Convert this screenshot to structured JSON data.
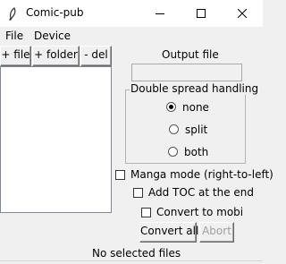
{
  "window": {
    "title": "Comic-pub"
  },
  "menu": {
    "items": [
      "File",
      "Device"
    ]
  },
  "toolbar": {
    "add_file": "+ file",
    "add_folder": "+ folder",
    "delete": "- del"
  },
  "output": {
    "label": "Output file",
    "value": ""
  },
  "spread": {
    "title": "Double spread handling",
    "options": [
      "none",
      "split",
      "both"
    ],
    "selected": "none"
  },
  "options": {
    "manga": {
      "label": "Manga mode (right-to-left)",
      "checked": false
    },
    "toc": {
      "label": "Add TOC at the end",
      "checked": false
    },
    "mobi": {
      "label": "Convert to mobi",
      "checked": false
    }
  },
  "actions": {
    "convert_all": "Convert all",
    "abort": "Abort"
  },
  "status": {
    "text": "No selected files"
  }
}
